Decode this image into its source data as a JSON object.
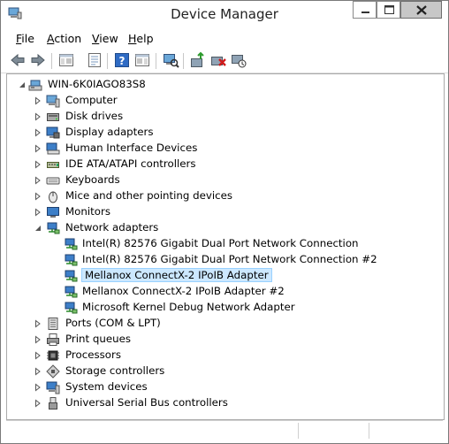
{
  "window": {
    "title": "Device Manager"
  },
  "menubar": {
    "items": [
      {
        "label": "File",
        "accel": "F",
        "rest": "ile"
      },
      {
        "label": "Action",
        "accel": "A",
        "rest": "ction"
      },
      {
        "label": "View",
        "accel": "V",
        "rest": "iew"
      },
      {
        "label": "Help",
        "accel": "H",
        "rest": "elp"
      }
    ]
  },
  "toolbar": {
    "buttons": [
      "back-icon",
      "forward-icon",
      "show-hide-console-tree-icon",
      "properties-icon",
      "help-icon",
      "show-hide-action-pane-icon",
      "scan-hardware-icon",
      "update-driver-icon",
      "uninstall-icon",
      "disable-device-icon"
    ]
  },
  "tree": {
    "root": "WIN-6K0IAGO83S8",
    "categories": [
      {
        "label": "Computer",
        "icon": "computer-icon",
        "expanded": false
      },
      {
        "label": "Disk drives",
        "icon": "disk-drive-icon",
        "expanded": false
      },
      {
        "label": "Display adapters",
        "icon": "display-adapter-icon",
        "expanded": false
      },
      {
        "label": "Human Interface Devices",
        "icon": "hid-icon",
        "expanded": false
      },
      {
        "label": "IDE ATA/ATAPI controllers",
        "icon": "ide-controller-icon",
        "expanded": false
      },
      {
        "label": "Keyboards",
        "icon": "keyboard-icon",
        "expanded": false
      },
      {
        "label": "Mice and other pointing devices",
        "icon": "mouse-icon",
        "expanded": false
      },
      {
        "label": "Monitors",
        "icon": "monitor-icon",
        "expanded": false
      },
      {
        "label": "Network adapters",
        "icon": "network-adapter-icon",
        "expanded": true,
        "children": [
          "Intel(R) 82576 Gigabit Dual Port Network Connection",
          "Intel(R) 82576 Gigabit Dual Port Network Connection #2",
          "Mellanox ConnectX-2 IPoIB Adapter",
          "Mellanox ConnectX-2 IPoIB Adapter #2",
          "Microsoft Kernel Debug Network Adapter"
        ],
        "selected_child": "Mellanox ConnectX-2 IPoIB Adapter"
      },
      {
        "label": "Ports (COM & LPT)",
        "icon": "port-icon",
        "expanded": false
      },
      {
        "label": "Print queues",
        "icon": "printer-icon",
        "expanded": false
      },
      {
        "label": "Processors",
        "icon": "processor-icon",
        "expanded": false
      },
      {
        "label": "Storage controllers",
        "icon": "storage-controller-icon",
        "expanded": false
      },
      {
        "label": "System devices",
        "icon": "system-device-icon",
        "expanded": false
      },
      {
        "label": "Universal Serial Bus controllers",
        "icon": "usb-icon",
        "expanded": false
      }
    ]
  },
  "colors": {
    "selection_bg": "#cce8ff",
    "selection_border": "#99d1ff"
  }
}
